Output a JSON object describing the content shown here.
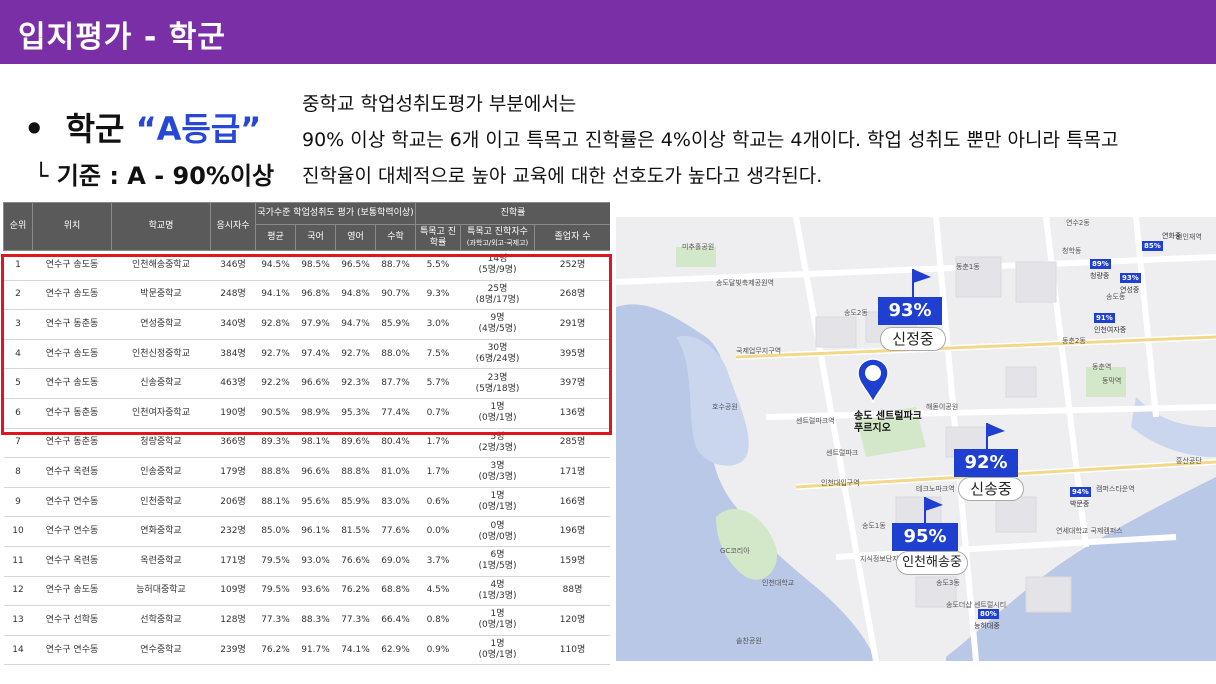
{
  "header": {
    "title": "입지평가 - 학군"
  },
  "summary": {
    "bullet": "•",
    "grade_prefix": "학군 ",
    "grade_value": "“A등급”",
    "criteria": "└ 기준 : A - 90%이상"
  },
  "description": [
    "중학교 학업성취도평가 부분에서는",
    " 90% 이상 학교는 6개 이고 특목고 진학률은 4%이상 학교는 4개이다. 학업 성취도 뿐만 아니라 특목고",
    "진학율이 대체적으로 높아 교육에 대한 선호도가 높다고 생각된다."
  ],
  "table": {
    "headers": {
      "rank": "순위",
      "location": "위치",
      "school": "학교명",
      "applicants": "응시자수",
      "group_national": "국가수준 학업성취도 평가 (보통학력이상)",
      "group_admission": "진학률",
      "avg": "평균",
      "korean": "국어",
      "english": "영어",
      "math": "수학",
      "special_rate": "특목고 진학률",
      "special_count": "특목고 진학자수",
      "special_count_sub": "(과학고/외고·국제고)",
      "graduates": "졸업자 수"
    },
    "rows": [
      [
        "1",
        "연수구 송도동",
        "인천해송중학교",
        "346명",
        "94.5%",
        "98.5%",
        "96.5%",
        "88.7%",
        "5.5%",
        "14명",
        "(5명/9명)",
        "252명"
      ],
      [
        "2",
        "연수구 송도동",
        "박문중학교",
        "248명",
        "94.1%",
        "96.8%",
        "94.8%",
        "90.7%",
        "9.3%",
        "25명",
        "(8명/17명)",
        "268명"
      ],
      [
        "3",
        "연수구 동춘동",
        "연성중학교",
        "340명",
        "92.8%",
        "97.9%",
        "94.7%",
        "85.9%",
        "3.0%",
        "9명",
        "(4명/5명)",
        "291명"
      ],
      [
        "4",
        "연수구 송도동",
        "인천신정중학교",
        "384명",
        "92.7%",
        "97.4%",
        "92.7%",
        "88.0%",
        "7.5%",
        "30명",
        "(6명/24명)",
        "395명"
      ],
      [
        "5",
        "연수구 송도동",
        "신송중학교",
        "463명",
        "92.2%",
        "96.6%",
        "92.3%",
        "87.7%",
        "5.7%",
        "23명",
        "(5명/18명)",
        "397명"
      ],
      [
        "6",
        "연수구 동춘동",
        "인천여자중학교",
        "190명",
        "90.5%",
        "98.9%",
        "95.3%",
        "77.4%",
        "0.7%",
        "1명",
        "(0명/1명)",
        "136명"
      ],
      [
        "7",
        "연수구 동춘동",
        "청량중학교",
        "366명",
        "89.3%",
        "98.1%",
        "89.6%",
        "80.4%",
        "1.7%",
        "5명",
        "(2명/3명)",
        "285명"
      ],
      [
        "8",
        "연수구 옥련동",
        "인송중학교",
        "179명",
        "88.8%",
        "96.6%",
        "88.8%",
        "81.0%",
        "1.7%",
        "3명",
        "(0명/3명)",
        "171명"
      ],
      [
        "9",
        "연수구 연수동",
        "인천중학교",
        "206명",
        "88.1%",
        "95.6%",
        "85.9%",
        "83.0%",
        "0.6%",
        "1명",
        "(0명/1명)",
        "166명"
      ],
      [
        "10",
        "연수구 연수동",
        "연화중학교",
        "232명",
        "85.0%",
        "96.1%",
        "81.5%",
        "77.6%",
        "0.0%",
        "0명",
        "(0명/0명)",
        "196명"
      ],
      [
        "11",
        "연수구 옥련동",
        "옥련중학교",
        "171명",
        "79.5%",
        "93.0%",
        "76.6%",
        "69.0%",
        "3.7%",
        "6명",
        "(1명/5명)",
        "159명"
      ],
      [
        "12",
        "연수구 송도동",
        "능허대중학교",
        "109명",
        "79.5%",
        "93.6%",
        "76.2%",
        "68.8%",
        "4.5%",
        "4명",
        "(1명/3명)",
        "88명"
      ],
      [
        "13",
        "연수구 선학동",
        "선학중학교",
        "128명",
        "77.3%",
        "88.3%",
        "77.3%",
        "66.4%",
        "0.8%",
        "1명",
        "(0명/1명)",
        "120명"
      ],
      [
        "14",
        "연수구 연수동",
        "연수중학교",
        "239명",
        "76.2%",
        "91.7%",
        "74.1%",
        "62.9%",
        "0.9%",
        "1명",
        "(0명/1명)",
        "110명"
      ]
    ]
  },
  "map": {
    "pin_label": "송도 센트럴파크 푸르지오",
    "schools": [
      {
        "pct": "93%",
        "name": "신정중"
      },
      {
        "pct": "92%",
        "name": "신송중"
      },
      {
        "pct": "95%",
        "name": "인천해송중"
      }
    ],
    "mini_schools": [
      {
        "pct": "85%",
        "name": "연화중"
      },
      {
        "pct": "89%",
        "name": "청량중"
      },
      {
        "pct": "93%",
        "name": "연성중"
      },
      {
        "pct": "91%",
        "name": "인천여자중"
      },
      {
        "pct": "94%",
        "name": "박문중"
      },
      {
        "pct": "80%",
        "name": "능허대중"
      }
    ],
    "labels": [
      "연수2동",
      "원인재역",
      "청학동",
      "동춘1동",
      "송도달빛축제공원역",
      "송도2동",
      "국제업무지구역",
      "센트럴파크역",
      "인천대입구역",
      "동춘역",
      "송도1동",
      "지식정보단지역",
      "동막역",
      "흥산공단",
      "송도동",
      "센트럴파크",
      "호수공원",
      "인천대학교",
      "송도3동",
      "연세대학교 국제캠퍼스",
      "해돋이공원",
      "테크노파크역",
      "캠퍼스타운역",
      "송도더샵 센트럴시티",
      "미추홀공원",
      "GC코리아",
      "솔찬공원",
      "동춘2동"
    ],
    "colors": {
      "badge": "#1f3fd0",
      "water": "#b9c8e6",
      "land": "#eeeef0",
      "park": "#d3e8c8",
      "highlight": "#e0161e"
    }
  }
}
